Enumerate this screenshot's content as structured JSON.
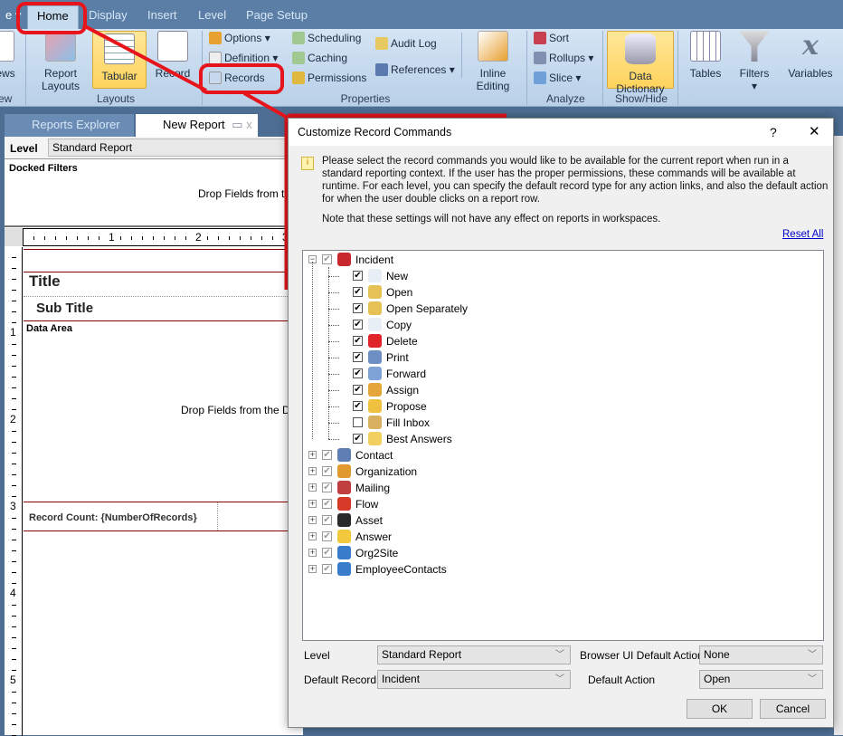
{
  "ribbon": {
    "tabs": [
      {
        "label": "Home",
        "active": true
      },
      {
        "label": "Display"
      },
      {
        "label": "Insert"
      },
      {
        "label": "Level"
      },
      {
        "label": "Page Setup"
      }
    ],
    "partial_left": {
      "label1": "ews",
      "label2": "ew"
    },
    "layouts": {
      "report_layouts": "Report Layouts",
      "tabular": "Tabular",
      "record": "Record",
      "label": "Layouts"
    },
    "properties": {
      "options": "Options",
      "definition": "Definition",
      "records": "Records",
      "scheduling": "Scheduling",
      "caching": "Caching",
      "permissions": "Permissions",
      "audit_log": "Audit Log",
      "references": "References",
      "inline_editing": "Inline Editing",
      "label": "Properties"
    },
    "analyze": {
      "sort": "Sort",
      "rollups": "Rollups",
      "slice": "Slice",
      "label": "Analyze"
    },
    "showhide": {
      "data_dictionary": "Data Dictionary",
      "label": "Show/Hide"
    },
    "tables": "Tables",
    "filters": "Filters",
    "variables": "Variables"
  },
  "doc_tabs": [
    {
      "label": "Reports Explorer"
    },
    {
      "label": "New Report",
      "active": true
    }
  ],
  "report": {
    "level_label": "Level",
    "level_value": "Standard Report",
    "docked_filters": "Docked Filters",
    "drop_fields_top": "Drop Fields from t",
    "title": "Title",
    "subtitle": "Sub Title",
    "data_area": "Data Area",
    "drop_fields_data": "Drop Fields from the D",
    "record_count": "Record Count: {NumberOfRecords}",
    "ruler_h": [
      "1",
      "2",
      "3"
    ],
    "ruler_v": [
      "1",
      "2",
      "3",
      "4",
      "5"
    ]
  },
  "dialog": {
    "title": "Customize Record Commands",
    "help": "?",
    "close": "✕",
    "info": "Please select the record commands you would like to be available for the current report when run in a standard reporting context. If the user has the proper permissions, these commands will be available at runtime. For each level, you can specify the default record type for any action links, and also the default action for when the user double clicks on a report row.",
    "note": "Note that these settings will not have any effect on reports in workspaces.",
    "reset_all": "Reset All",
    "tree": {
      "root": {
        "label": "Incident",
        "checked": true,
        "expanded": true,
        "color": "#c8282d",
        "children": [
          {
            "label": "New",
            "checked": true,
            "color": "#e8eef6"
          },
          {
            "label": "Open",
            "checked": true,
            "color": "#e6c155"
          },
          {
            "label": "Open Separately",
            "checked": true,
            "color": "#e6c155"
          },
          {
            "label": "Copy",
            "checked": true,
            "color": "#e8eef6"
          },
          {
            "label": "Delete",
            "checked": true,
            "color": "#e0262b"
          },
          {
            "label": "Print",
            "checked": true,
            "color": "#6d8fc4"
          },
          {
            "label": "Forward",
            "checked": true,
            "color": "#7fa3d6"
          },
          {
            "label": "Assign",
            "checked": true,
            "color": "#e6a53a"
          },
          {
            "label": "Propose",
            "checked": true,
            "color": "#f0c040"
          },
          {
            "label": "Fill Inbox",
            "checked": false,
            "color": "#d9b060"
          },
          {
            "label": "Best Answers",
            "checked": true,
            "color": "#f2d060"
          }
        ]
      },
      "others": [
        {
          "label": "Contact",
          "checked": true,
          "color": "#5f7fb4"
        },
        {
          "label": "Organization",
          "checked": true,
          "color": "#e09a30"
        },
        {
          "label": "Mailing",
          "checked": true,
          "color": "#c04040"
        },
        {
          "label": "Flow",
          "checked": true,
          "color": "#d83a2a"
        },
        {
          "label": "Asset",
          "checked": true,
          "color": "#2a2a2a"
        },
        {
          "label": "Answer",
          "checked": true,
          "color": "#f2c83c"
        },
        {
          "label": "Org2Site",
          "checked": true,
          "color": "#3a7ccc"
        },
        {
          "label": "EmployeeContacts",
          "checked": true,
          "color": "#3a7ccc"
        }
      ]
    },
    "level_label": "Level",
    "level_value": "Standard Report",
    "default_record_label": "Default Record",
    "default_record_value": "Incident",
    "browser_action_label": "Browser UI Default Action",
    "browser_action_value": "None",
    "default_action_label": "Default Action",
    "default_action_value": "Open",
    "ok": "OK",
    "cancel": "Cancel"
  },
  "annotation_color": "#e8141c"
}
